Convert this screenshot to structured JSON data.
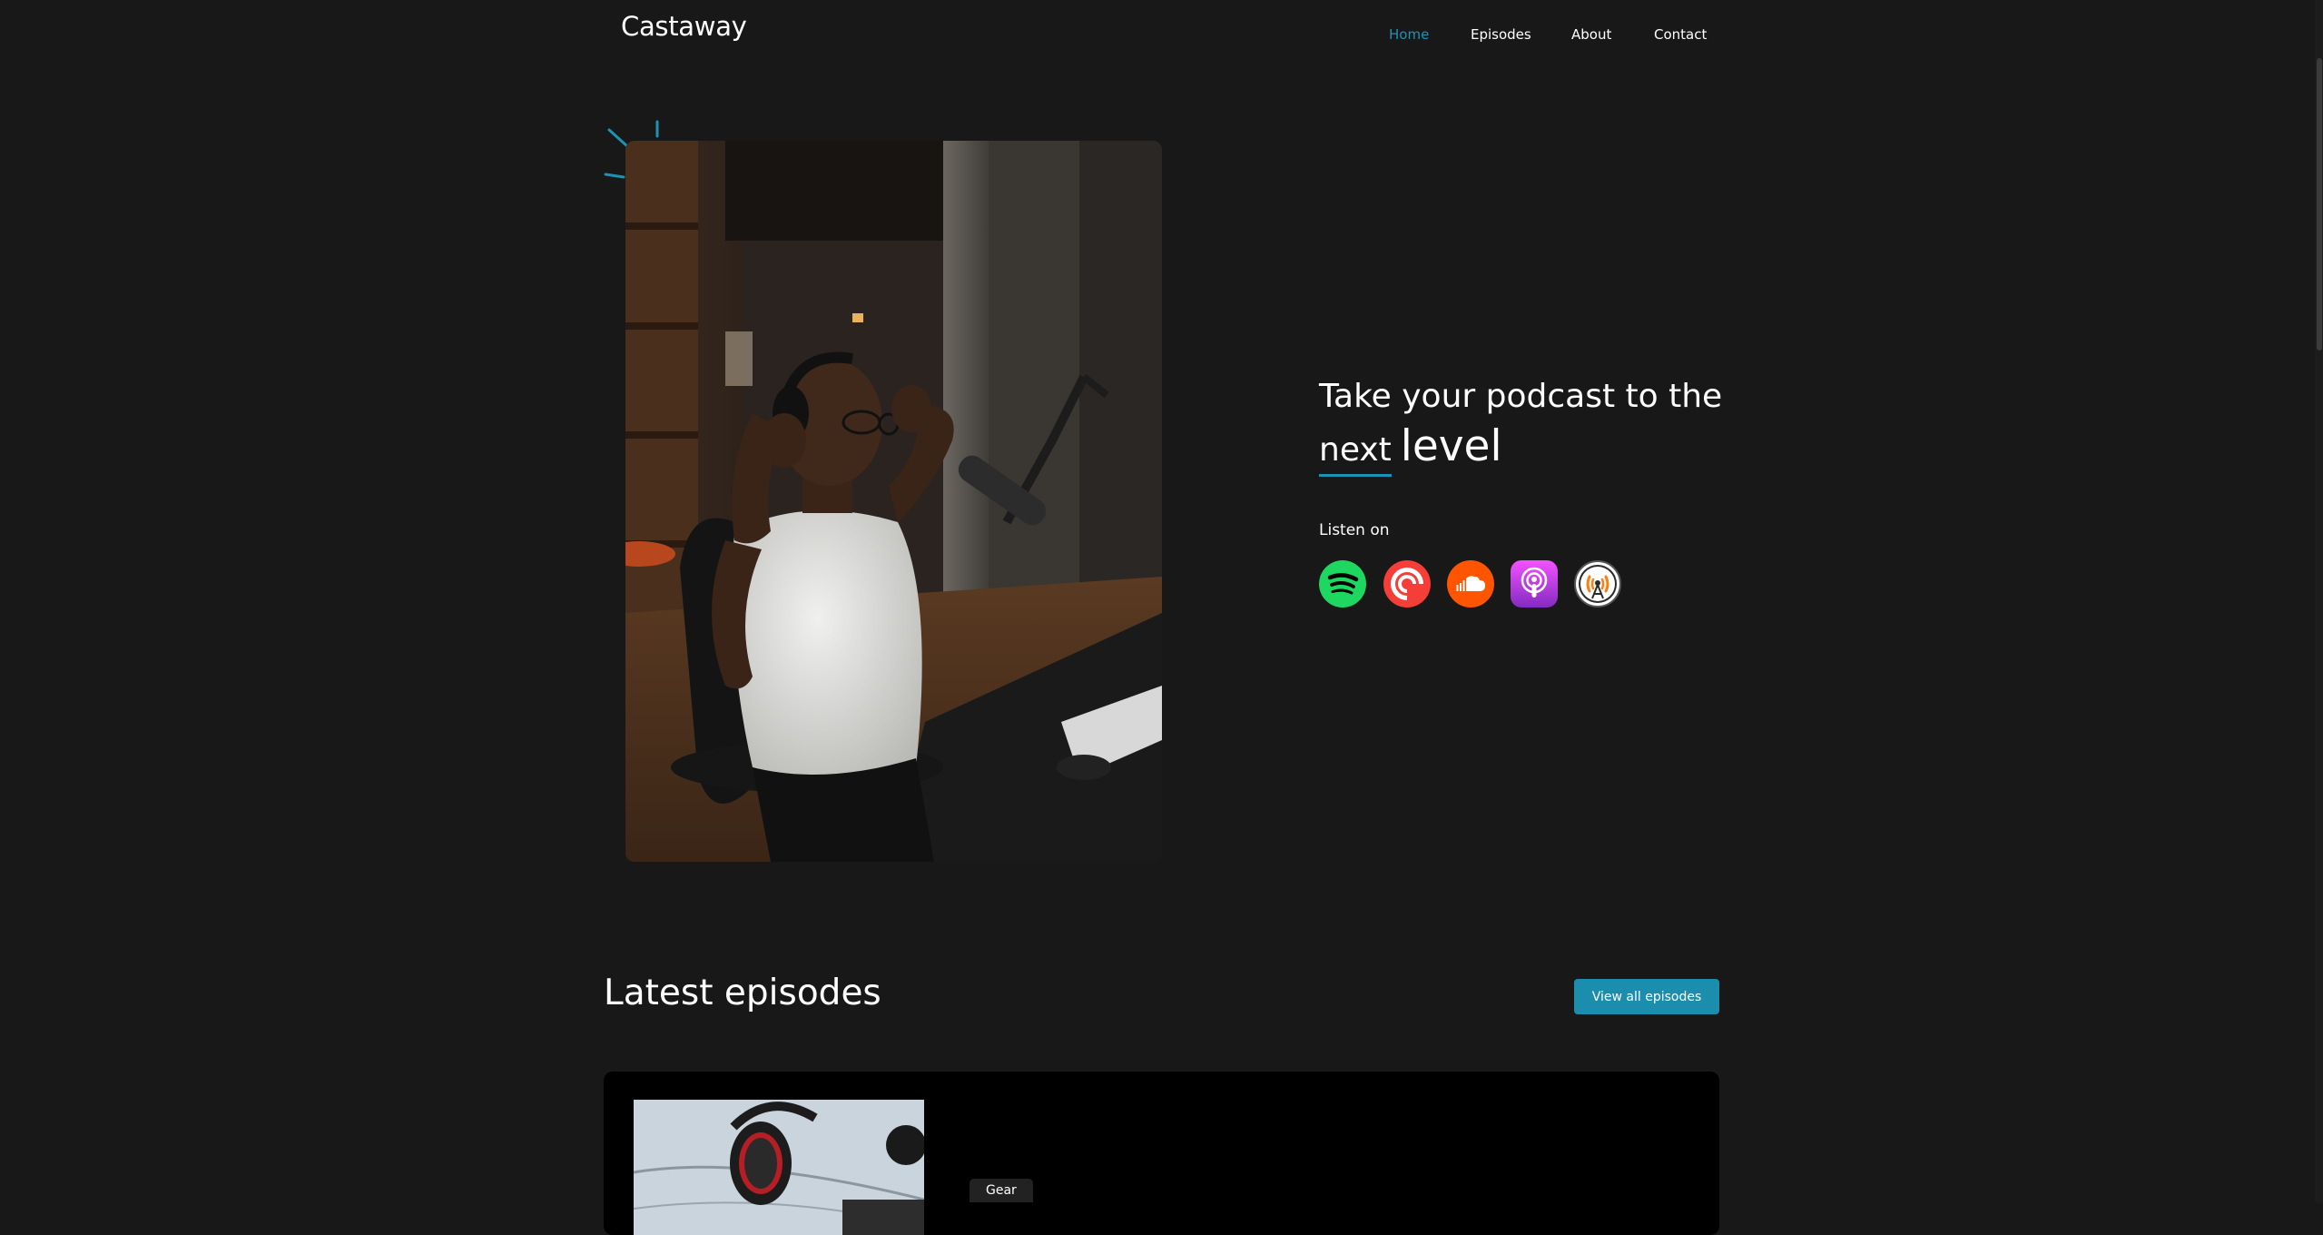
{
  "brand": {
    "name": "Castaway"
  },
  "nav": {
    "items": [
      {
        "label": "Home",
        "active": true
      },
      {
        "label": "Episodes",
        "active": false
      },
      {
        "label": "About",
        "active": false
      },
      {
        "label": "Contact",
        "active": false
      }
    ]
  },
  "hero": {
    "heading_line1": "Take your podcast to the",
    "heading_next": "next",
    "heading_level": "level",
    "listen_label": "Listen on",
    "platforms": [
      {
        "name": "Spotify",
        "icon": "spotify-icon",
        "color": "#1ed760"
      },
      {
        "name": "Pocket Casts",
        "icon": "pocket-casts-icon",
        "color": "#f43e37"
      },
      {
        "name": "SoundCloud",
        "icon": "soundcloud-icon",
        "color": "#ff5500"
      },
      {
        "name": "Apple Podcasts",
        "icon": "apple-podcasts-icon",
        "color": "#9933cc"
      },
      {
        "name": "Overcast",
        "icon": "overcast-icon",
        "color": "#fc7e0f"
      }
    ]
  },
  "latest": {
    "title": "Latest episodes",
    "view_all_label": "View all episodes",
    "episodes": [
      {
        "tag": "Gear"
      }
    ]
  },
  "colors": {
    "background": "#181818",
    "accent": "#1b93b5",
    "card": "#000000"
  }
}
